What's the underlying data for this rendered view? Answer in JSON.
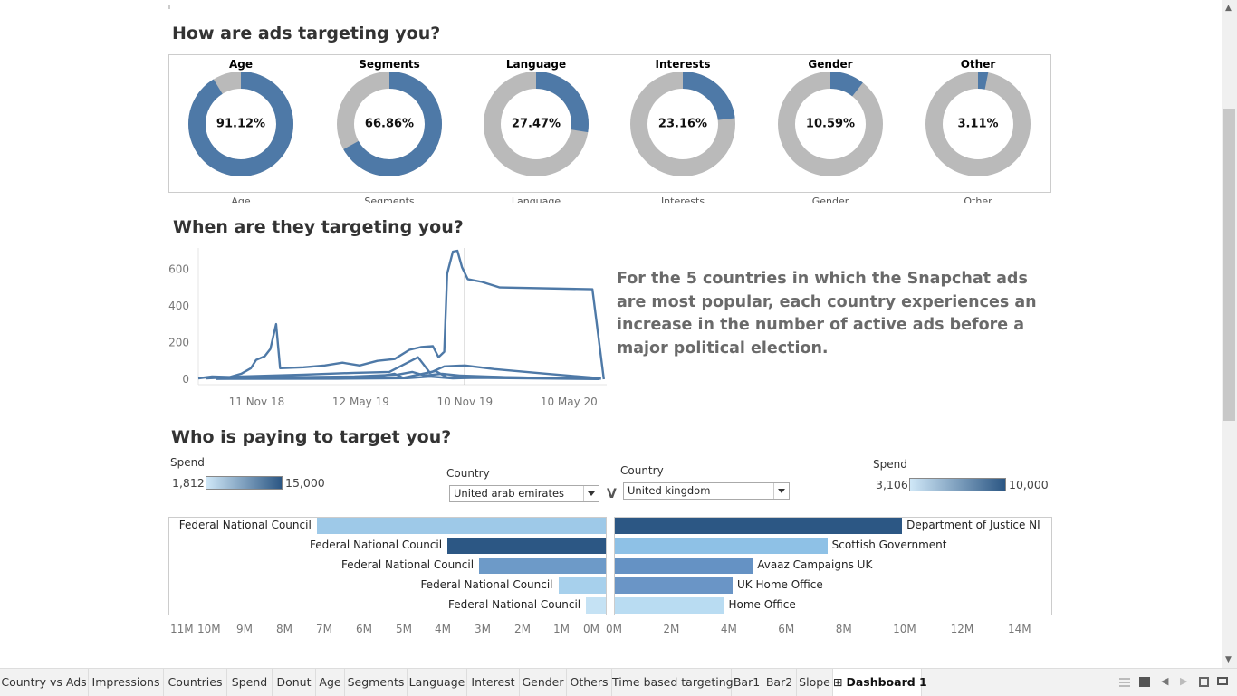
{
  "sections": {
    "ads_title": "How are ads targeting you?",
    "time_title": "When are they targeting you?",
    "pay_title": "Who is paying to target you?"
  },
  "donuts": [
    {
      "title": "Age",
      "pct_label": "91.12%",
      "value": 0.9112
    },
    {
      "title": "Segments",
      "pct_label": "66.86%",
      "value": 0.6686
    },
    {
      "title": "Language",
      "pct_label": "27.47%",
      "value": 0.2747
    },
    {
      "title": "Interests",
      "pct_label": "23.16%",
      "value": 0.2316
    },
    {
      "title": "Gender",
      "pct_label": "10.59%",
      "value": 0.1059
    },
    {
      "title": "Other",
      "pct_label": "3.11%",
      "value": 0.0311
    }
  ],
  "colors": {
    "accent": "#4e79a7",
    "gray": "#bababa",
    "dark": "#2c5784",
    "light": "#9ec9e8"
  },
  "chart_data": [
    {
      "type": "line",
      "y_ticks": [
        "0",
        "200",
        "400",
        "600"
      ],
      "x_ticks": [
        "11 Nov 18",
        "12 May 19",
        "10 Nov 19",
        "10 May 20"
      ],
      "ylim": [
        0,
        700
      ],
      "xlim": [
        "2018-08-01",
        "2020-07-15"
      ],
      "reference_line_x": "2019-11-10",
      "series": [
        {
          "points": [
            [
              "2018-08-01",
              5
            ],
            [
              "2018-08-25",
              15
            ],
            [
              "2018-09-25",
              12
            ],
            [
              "2018-10-15",
              30
            ],
            [
              "2018-11-01",
              60
            ],
            [
              "2018-11-10",
              105
            ],
            [
              "2018-11-25",
              125
            ],
            [
              "2018-12-05",
              165
            ],
            [
              "2018-12-15",
              300
            ],
            [
              "2018-12-22",
              60
            ],
            [
              "2019-02-01",
              65
            ],
            [
              "2019-03-10",
              75
            ],
            [
              "2019-04-10",
              90
            ],
            [
              "2019-05-10",
              75
            ],
            [
              "2019-06-10",
              100
            ],
            [
              "2019-07-10",
              110
            ],
            [
              "2019-08-05",
              160
            ],
            [
              "2019-08-25",
              175
            ],
            [
              "2019-09-15",
              180
            ],
            [
              "2019-09-25",
              120
            ],
            [
              "2019-10-05",
              150
            ],
            [
              "2019-10-10",
              575
            ],
            [
              "2019-10-20",
              695
            ],
            [
              "2019-10-28",
              700
            ],
            [
              "2019-11-05",
              610
            ],
            [
              "2019-11-15",
              545
            ],
            [
              "2019-12-10",
              530
            ],
            [
              "2020-01-10",
              500
            ],
            [
              "2020-06-20",
              490
            ],
            [
              "2020-07-10",
              0
            ]
          ]
        },
        {
          "points": [
            [
              "2018-08-15",
              5
            ],
            [
              "2018-10-15",
              15
            ],
            [
              "2019-02-01",
              25
            ],
            [
              "2019-05-01",
              35
            ],
            [
              "2019-07-01",
              40
            ],
            [
              "2019-08-20",
              120
            ],
            [
              "2019-09-10",
              35
            ],
            [
              "2019-10-05",
              70
            ],
            [
              "2019-11-10",
              75
            ],
            [
              "2020-01-01",
              55
            ],
            [
              "2020-04-01",
              30
            ],
            [
              "2020-07-05",
              5
            ]
          ]
        },
        {
          "points": [
            [
              "2018-08-20",
              8
            ],
            [
              "2018-11-01",
              10
            ],
            [
              "2019-02-01",
              12
            ],
            [
              "2019-05-01",
              15
            ],
            [
              "2019-07-15",
              25
            ],
            [
              "2019-08-10",
              40
            ],
            [
              "2019-09-01",
              20
            ],
            [
              "2019-10-01",
              30
            ],
            [
              "2019-11-01",
              20
            ],
            [
              "2020-02-01",
              10
            ],
            [
              "2020-07-05",
              3
            ]
          ]
        },
        {
          "points": [
            [
              "2018-09-01",
              3
            ],
            [
              "2019-03-01",
              5
            ],
            [
              "2019-06-01",
              10
            ],
            [
              "2019-07-10",
              30
            ],
            [
              "2019-07-25",
              8
            ],
            [
              "2019-09-20",
              45
            ],
            [
              "2019-10-10",
              10
            ],
            [
              "2019-11-15",
              15
            ],
            [
              "2020-07-01",
              2
            ]
          ]
        },
        {
          "points": [
            [
              "2018-09-01",
              2
            ],
            [
              "2019-04-01",
              3
            ],
            [
              "2019-08-01",
              6
            ],
            [
              "2019-09-10",
              15
            ],
            [
              "2019-10-20",
              5
            ],
            [
              "2019-12-01",
              8
            ],
            [
              "2020-07-01",
              1
            ]
          ]
        }
      ]
    },
    {
      "type": "bar",
      "orientation": "horizontal",
      "categories": [
        "Federal National Council",
        "Federal National Council",
        "Federal National Council",
        "Federal National Council",
        "Federal National Council"
      ],
      "values": [
        7300000,
        4000000,
        3200000,
        1200000,
        500000
      ],
      "colors": [
        "#9ec9e8",
        "#2c5784",
        "#6d9ac8",
        "#a7d0ec",
        "#c5e2f4"
      ],
      "x_ticks": [
        "11M",
        "10M",
        "9M",
        "8M",
        "7M",
        "6M",
        "5M",
        "4M",
        "3M",
        "2M",
        "1M",
        "0M"
      ],
      "xlim": [
        11000000,
        0
      ]
    },
    {
      "type": "bar",
      "orientation": "horizontal",
      "categories": [
        "Department of Justice NI",
        "Scottish Government",
        "Avaaz Campaigns UK",
        "UK Home Office",
        "Home Office"
      ],
      "values": [
        10000000,
        7400000,
        4800000,
        4100000,
        3800000
      ],
      "colors": [
        "#2c5784",
        "#8ec1e6",
        "#6592c4",
        "#6a95c6",
        "#b9dcf2"
      ],
      "x_ticks": [
        "0M",
        "2M",
        "4M",
        "6M",
        "8M",
        "10M",
        "12M",
        "14M"
      ],
      "xlim": [
        0,
        15000000
      ]
    }
  ],
  "legend_left": {
    "title": "Spend",
    "min": "1,812",
    "max": "15,000"
  },
  "legend_right": {
    "title": "Spend",
    "min": "3,106",
    "max": "10,000"
  },
  "filter_left": {
    "label": "Country",
    "value": "United arab emirates"
  },
  "filter_right": {
    "label": "Country",
    "value": "United kingdom"
  },
  "vs_label": "V",
  "note": "For the 5 countries in which the Snapchat ads are most popular, each country experiences an increase in the number of active ads before a major political election.",
  "tabs": [
    "Country vs Ads",
    "Impressions",
    "Countries",
    "Spend",
    "Donut",
    "Age",
    "Segments",
    "Language",
    "Interest",
    "Gender",
    "Others",
    "Time based targeting",
    "Bar1",
    "Bar2",
    "Slope",
    "Dashboard 1"
  ],
  "active_tab": "Dashboard 1"
}
